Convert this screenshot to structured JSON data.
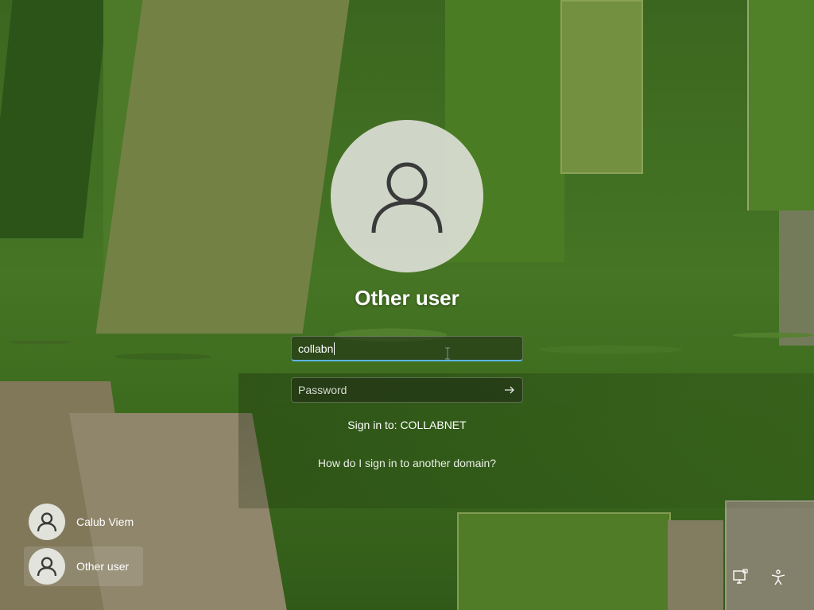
{
  "login": {
    "account_name": "Other user",
    "username_value": "collabn",
    "password_placeholder": "Password",
    "sign_in_to": "Sign in to: COLLABNET",
    "other_domain_link": "How do I sign in to another domain?"
  },
  "user_list": [
    {
      "name": "Calub Viem",
      "selected": false
    },
    {
      "name": "Other user",
      "selected": true
    }
  ],
  "icons": {
    "avatar": "user-silhouette-icon",
    "submit": "arrow-right-icon",
    "network": "network-icon",
    "accessibility": "accessibility-icon",
    "cursor": "text-cursor-icon"
  },
  "colors": {
    "focus_underline": "#5bb3e6"
  }
}
